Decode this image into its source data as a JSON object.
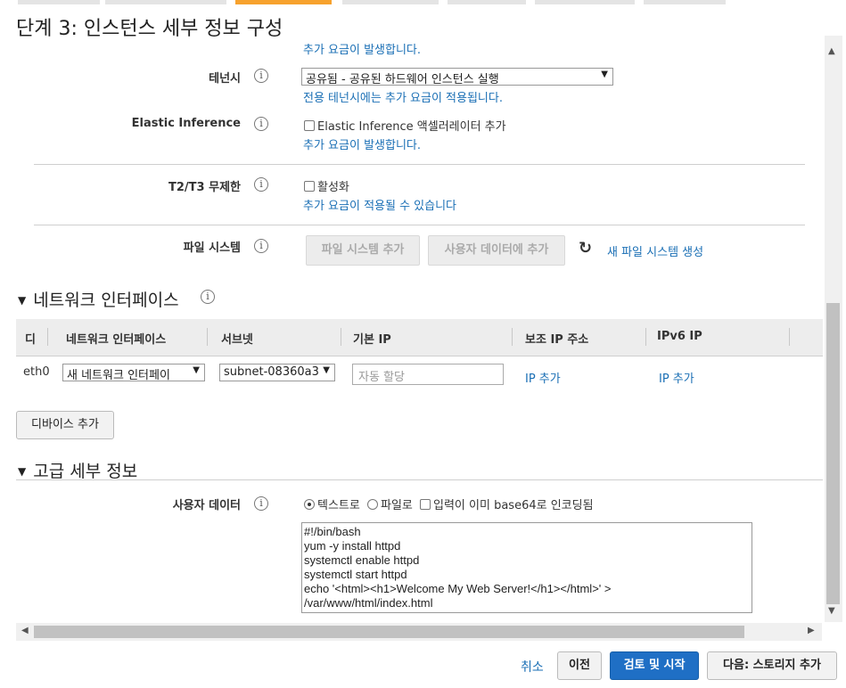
{
  "page_title": "단계 3: 인스턴스 세부 정보 구성",
  "top_note": "추가 요금이 발생합니다.",
  "tenancy": {
    "label": "테넌시",
    "selected": "공유됨 - 공유된 하드웨어 인스턴스 실행",
    "note": "전용 테넌시에는 추가 요금이 적용됩니다."
  },
  "elastic_inference": {
    "label": "Elastic Inference",
    "checkbox_label": "Elastic Inference 액셀러레이터 추가",
    "note": "추가 요금이 발생합니다."
  },
  "t2t3": {
    "label": "T2/T3 무제한",
    "checkbox_label": "활성화",
    "note": "추가 요금이 적용될 수 있습니다"
  },
  "file_system": {
    "label": "파일 시스템",
    "add_button": "파일 시스템 추가",
    "user_data_button": "사용자 데이터에 추가",
    "create_link": "새 파일 시스템 생성"
  },
  "network_section": {
    "title": "네트워크 인터페이스",
    "columns": [
      "디",
      "네트워크 인터페이스",
      "서브넷",
      "기본 IP",
      "보조 IP 주소",
      "IPv6 IP"
    ],
    "row": {
      "device": "eth0",
      "interface": "새 네트워크 인터페이",
      "subnet": "subnet-08360a3",
      "primary_ip_placeholder": "자동 할당",
      "secondary_ip": "IP 추가",
      "ipv6": "IP 추가"
    },
    "add_device_button": "디바이스 추가"
  },
  "advanced_section": {
    "title": "고급 세부 정보",
    "user_data_label": "사용자 데이터",
    "radio_text": "텍스트로",
    "radio_file": "파일로",
    "base64_checkbox": "입력이 이미 base64로 인코딩됨",
    "user_data_value": "#!/bin/bash\nyum -y install httpd\nsystemctl enable httpd\nsystemctl start httpd\necho '<html><h1>Welcome My Web Server!</h1></html>' >\n/var/www/html/index.html"
  },
  "footer": {
    "cancel": "취소",
    "previous": "이전",
    "review_launch": "검토 및 시작",
    "next": "다음: 스토리지 추가"
  },
  "colors": {
    "accent": "#1f6fc5",
    "link": "#1a6fb5",
    "active_tab": "#f7a22d"
  }
}
